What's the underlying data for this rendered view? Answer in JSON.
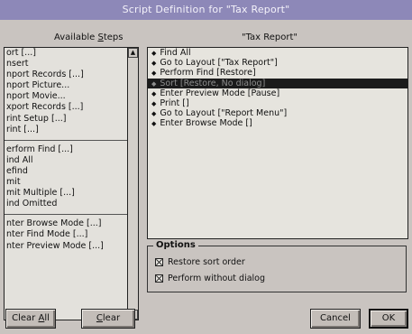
{
  "window": {
    "title": "Script Definition for \"Tax Report\""
  },
  "available_steps": {
    "label_pre": "Available ",
    "label_underlined": "S",
    "label_post": "teps",
    "items": [
      "ort [...]",
      "nsert",
      "nport Records [...]",
      "nport Picture...",
      "nport Movie...",
      "xport Records [...]",
      "rint Setup [...]",
      "rint [...]",
      "erform Find [...]",
      "ind All",
      "efind",
      "mit",
      "mit Multiple [...]",
      "ind Omitted",
      "nter Browse Mode [...]",
      "nter Find Mode [...]",
      "nter Preview Mode [...]"
    ]
  },
  "script": {
    "header": "\"Tax Report\"",
    "lines": [
      "Find All",
      "Go to Layout [\"Tax Report\"]",
      "Perform Find [Restore]",
      "Sort [Restore, No dialog]",
      "Enter Preview Mode [Pause]",
      "Print []",
      "Go to Layout [\"Report Menu\"]",
      "Enter Browse Mode []"
    ],
    "selected_index": 3
  },
  "options": {
    "title": "Options",
    "restore_sort_order": {
      "label": "Restore sort order",
      "checked": true
    },
    "perform_without_dialog": {
      "label": "Perform without dialog",
      "checked": true
    }
  },
  "buttons": {
    "clear_all": {
      "pre": "Clear ",
      "ul": "A",
      "post": "ll"
    },
    "clear": {
      "pre": "",
      "ul": "C",
      "post": "lear"
    },
    "cancel": "Cancel",
    "ok": "OK"
  }
}
